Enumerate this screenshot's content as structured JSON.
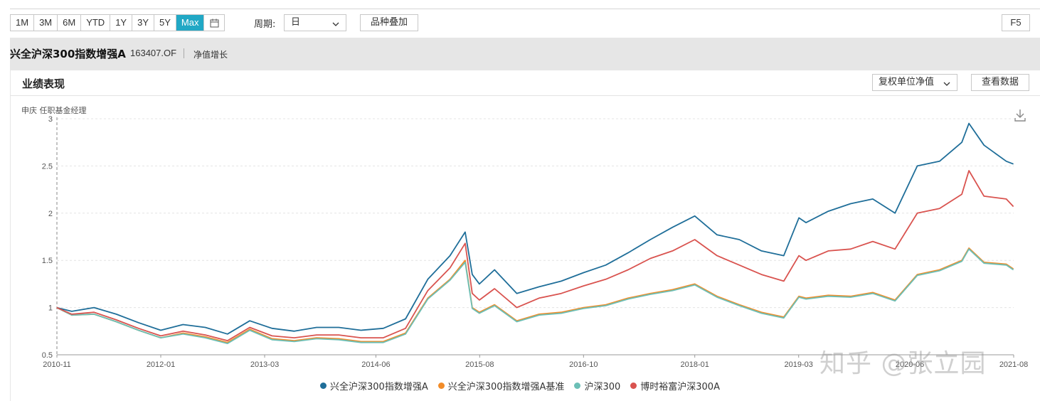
{
  "toolbar": {
    "ranges": [
      "1M",
      "3M",
      "6M",
      "YTD",
      "1Y",
      "3Y",
      "5Y",
      "Max"
    ],
    "active_range": "Max",
    "period_label": "周期:",
    "period_value": "日",
    "overlay_label": "品种叠加",
    "f5_label": "F5"
  },
  "fund": {
    "name": "兴全沪深300指数增强A",
    "code": "163407.OF",
    "tag": "净值增长"
  },
  "panel": {
    "title": "业绩表现",
    "nav_type": "复权单位净值",
    "view_data_label": "查看数据"
  },
  "manager_note": "申庆 任职基金经理",
  "watermark": "知乎 @张立园",
  "colors": {
    "accent": "#21a8c5",
    "fund": "#1f6e99",
    "benchmark": "#f28c28",
    "hs300": "#6cbfb6",
    "boshi": "#d9534f"
  },
  "chart_data": {
    "type": "line",
    "title": "",
    "xlabel": "",
    "ylabel": "",
    "xlim": [
      2010.833,
      2021.583
    ],
    "ylim": [
      0.5,
      3
    ],
    "yticks": [
      0.5,
      1,
      1.5,
      2,
      2.5,
      3
    ],
    "ytick_labels": [
      "0.5",
      "1",
      "1.5",
      "2",
      "2.5",
      "3"
    ],
    "xticks": [
      2010.833,
      2012.0,
      2013.167,
      2014.417,
      2015.583,
      2016.75,
      2018.0,
      2019.167,
      2020.417,
      2021.583
    ],
    "xtick_labels": [
      "2010-11",
      "2012-01",
      "2013-03",
      "2014-06",
      "2015-08",
      "2016-10",
      "2018-01",
      "2019-03",
      "2020-06",
      "2021-08"
    ],
    "grid": true,
    "legend_position": "bottom",
    "x": [
      2010.83,
      2011.0,
      2011.25,
      2011.5,
      2011.75,
      2012.0,
      2012.25,
      2012.5,
      2012.75,
      2013.0,
      2013.25,
      2013.5,
      2013.75,
      2014.0,
      2014.25,
      2014.5,
      2014.75,
      2015.0,
      2015.25,
      2015.42,
      2015.5,
      2015.58,
      2015.75,
      2016.0,
      2016.25,
      2016.5,
      2016.75,
      2017.0,
      2017.25,
      2017.5,
      2017.75,
      2018.0,
      2018.25,
      2018.5,
      2018.75,
      2019.0,
      2019.17,
      2019.25,
      2019.5,
      2019.75,
      2020.0,
      2020.25,
      2020.5,
      2020.75,
      2021.0,
      2021.08,
      2021.25,
      2021.5,
      2021.58
    ],
    "series": [
      {
        "name": "兴全沪深300指数增强A",
        "color": "#1f6e99",
        "values": [
          1.0,
          0.96,
          1.0,
          0.93,
          0.84,
          0.76,
          0.82,
          0.79,
          0.72,
          0.86,
          0.78,
          0.75,
          0.79,
          0.79,
          0.76,
          0.78,
          0.88,
          1.3,
          1.55,
          1.8,
          1.35,
          1.25,
          1.4,
          1.15,
          1.22,
          1.28,
          1.37,
          1.45,
          1.58,
          1.72,
          1.85,
          1.97,
          1.77,
          1.72,
          1.6,
          1.55,
          1.95,
          1.9,
          2.02,
          2.1,
          2.15,
          2.0,
          2.5,
          2.55,
          2.75,
          2.95,
          2.72,
          2.55,
          2.52
        ]
      },
      {
        "name": "兴全沪深300指数增强A基准",
        "color": "#f28c28",
        "values": [
          1.0,
          0.92,
          0.93,
          0.85,
          0.76,
          0.68,
          0.73,
          0.69,
          0.63,
          0.77,
          0.67,
          0.65,
          0.68,
          0.67,
          0.64,
          0.64,
          0.73,
          1.1,
          1.3,
          1.5,
          1.0,
          0.95,
          1.03,
          0.86,
          0.93,
          0.95,
          1.0,
          1.03,
          1.1,
          1.15,
          1.19,
          1.25,
          1.12,
          1.03,
          0.95,
          0.9,
          1.12,
          1.1,
          1.13,
          1.12,
          1.16,
          1.08,
          1.35,
          1.4,
          1.5,
          1.63,
          1.48,
          1.46,
          1.41
        ]
      },
      {
        "name": "沪深300",
        "color": "#6cbfb6",
        "values": [
          1.0,
          0.92,
          0.93,
          0.85,
          0.76,
          0.68,
          0.72,
          0.68,
          0.62,
          0.76,
          0.66,
          0.64,
          0.67,
          0.66,
          0.63,
          0.63,
          0.72,
          1.09,
          1.29,
          1.48,
          0.99,
          0.94,
          1.02,
          0.85,
          0.92,
          0.94,
          0.99,
          1.02,
          1.09,
          1.14,
          1.18,
          1.24,
          1.11,
          1.02,
          0.94,
          0.89,
          1.11,
          1.09,
          1.12,
          1.11,
          1.15,
          1.07,
          1.34,
          1.39,
          1.49,
          1.62,
          1.47,
          1.45,
          1.4
        ]
      },
      {
        "name": "博时裕富沪深300A",
        "color": "#d9534f",
        "values": [
          1.0,
          0.93,
          0.95,
          0.87,
          0.78,
          0.7,
          0.75,
          0.71,
          0.65,
          0.79,
          0.7,
          0.68,
          0.71,
          0.71,
          0.68,
          0.68,
          0.78,
          1.18,
          1.42,
          1.68,
          1.15,
          1.08,
          1.2,
          1.0,
          1.1,
          1.15,
          1.23,
          1.3,
          1.4,
          1.52,
          1.6,
          1.72,
          1.55,
          1.45,
          1.35,
          1.28,
          1.55,
          1.5,
          1.6,
          1.62,
          1.7,
          1.62,
          2.0,
          2.05,
          2.2,
          2.45,
          2.18,
          2.15,
          2.07
        ]
      }
    ]
  }
}
